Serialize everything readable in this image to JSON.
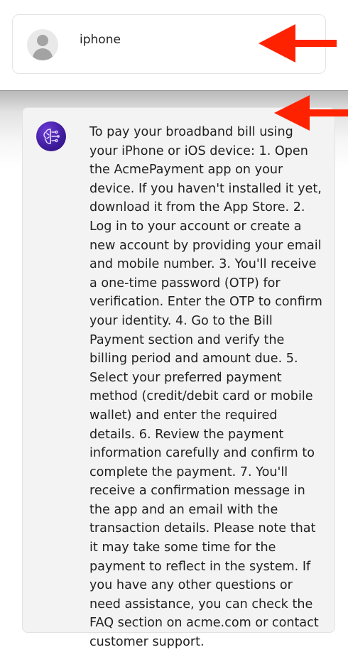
{
  "query_card": {
    "avatar_icon": "user-avatar-icon",
    "query_text": "iphone"
  },
  "response_card": {
    "avatar_icon": "ai-brain-circuit-icon",
    "response_text": "To pay your broadband bill using your iPhone or iOS device: 1. Open the AcmePayment app on your device. If you haven't installed it yet, download it from the App Store. 2. Log in to your account or create a new account by providing your email and mobile number. 3. You'll receive a one-time password (OTP) for verification. Enter the OTP to confirm your identity. 4. Go to the Bill Payment section and verify the billing period and amount due. 5. Select your preferred payment method (credit/debit card or mobile wallet) and enter the required details. 6. Review the payment information carefully and confirm to complete the payment. 7. You'll receive a confirmation message in the app and an email with the transaction details. Please note that it may take some time for the payment to reflect in the system. If you have any other questions or need assistance, you can check the FAQ section on acme.com or contact customer support."
  },
  "annotations": {
    "arrow_color": "#ff2200",
    "arrow_icon": "red-arrow-left-icon"
  },
  "colors": {
    "bot_avatar": "#4a24b0",
    "card_background": "#f3f3f3"
  }
}
